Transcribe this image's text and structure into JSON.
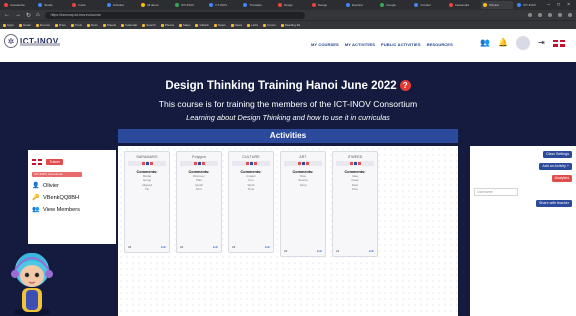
{
  "browser": {
    "tabs": [
      {
        "title": "Cassandra",
        "color": "#e8453c"
      },
      {
        "title": "Studio",
        "color": "#4285f4"
      },
      {
        "title": "Invite",
        "color": "#e8453c"
      },
      {
        "title": "Activities",
        "color": "#4285f4"
      },
      {
        "title": "All about",
        "color": "#fbbc05"
      },
      {
        "title": "ICT-INOV",
        "color": "#34a853"
      },
      {
        "title": "CT-INOV",
        "color": "#4285f4"
      },
      {
        "title": "Translate",
        "color": "#4285f4"
      },
      {
        "title": "Design",
        "color": "#e8453c"
      },
      {
        "title": "Design",
        "color": "#e8453c"
      },
      {
        "title": "Explorer",
        "color": "#4285f4"
      },
      {
        "title": "Google",
        "color": "#34a853"
      },
      {
        "title": "Contact",
        "color": "#4285f4"
      },
      {
        "title": "Cassandra",
        "color": "#e8453c"
      },
      {
        "title": "Shinkai",
        "color": "#fbbc05"
      },
      {
        "title": "ICT-INOV",
        "color": "#4285f4"
      }
    ],
    "url": "https://inovmap.ict-inov.eu/course",
    "window_controls": [
      "–",
      "□",
      "×"
    ],
    "bookmarks": [
      "Apps",
      "Gmail",
      "Forums",
      "Drive",
      "Tools",
      "Docs",
      "Sheets",
      "Calendar",
      "Search",
      "Photos",
      "Maps",
      "GitHub",
      "Notes",
      "News",
      "Links",
      "Forms",
      "Reading list"
    ]
  },
  "header": {
    "logo_text": "ICT-INOV",
    "nav": [
      "MY COURSES",
      "MY ACTIVITIES",
      "PUBLIC ACTIVITIES",
      "RESOURCES"
    ]
  },
  "course": {
    "title": "Design Thinking Training Hanoi June 2022",
    "help_glyph": "?",
    "subtitle": "This course is for training the members of the ICT-INOV Consortium",
    "tagline": "Learning about Design Thinking and how to use it in curriculas"
  },
  "activities": {
    "heading": "Activities",
    "cards": [
      {
        "title": "SARAMARO",
        "comments_label": "Comments:",
        "comments": [
          "Media",
          "Group",
          "Aligned",
          "Tip"
        ],
        "count": "26",
        "link": "Edit"
      },
      {
        "title": "Polygon",
        "comments_label": "Comments:",
        "comments": [
          "Discover",
          "Plan",
          "Quick",
          "Run"
        ],
        "count": "24",
        "link": "Edit"
      },
      {
        "title": "CULTURE",
        "comments_label": "Comments:",
        "comments": [
          "Impact",
          "Fun",
          "Work",
          "Time"
        ],
        "count": "29",
        "link": "Edit"
      },
      {
        "title": "ART",
        "comments_label": "Comments:",
        "comments": [
          "Nice",
          "Source",
          "Jump"
        ],
        "count": "23",
        "link": "Edit"
      },
      {
        "title": "ITWEED",
        "comments_label": "Comments:",
        "comments": [
          "Idea",
          "Clear",
          "Note",
          "Fine"
        ],
        "count": "21",
        "link": "Edit"
      }
    ]
  },
  "left_panel": {
    "badge": "Trainer",
    "badge2": "ICT-INOV Consortium",
    "user": "Olivier",
    "code": "VBenkQQ8BH",
    "members_link": "View Members"
  },
  "right_panel": {
    "buttons": [
      {
        "label": "Class Settings",
        "color": "#2c4a9b"
      },
      {
        "label": "Add an Activity +",
        "color": "#2c4a9b"
      },
      {
        "label": "Analytics",
        "color": "#e04b4b"
      }
    ],
    "input_placeholder": "Username",
    "share_button": "Share with teacher"
  },
  "colors": {
    "banner": "#141b3e",
    "accent": "#2c4a9b",
    "danger": "#e04b4b",
    "help": "#e53935"
  }
}
